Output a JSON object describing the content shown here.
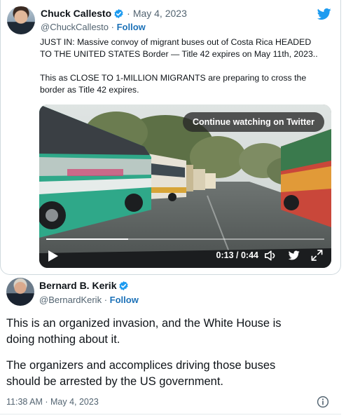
{
  "quoted_tweet": {
    "author_name": "Chuck Callesto",
    "date_sep": "·",
    "date": "May 4, 2023",
    "handle": "@ChuckCallesto",
    "handle_sep": "·",
    "follow_label": "Follow",
    "paragraphs": [
      "JUST IN: Massive convoy of migrant buses out of Costa Rica HEADED\nTO THE UNITED STATES Border — Title 42 expires on May 11th, 2023..",
      "This as CLOSE TO 1-MILLION MIGRANTS are preparing to cross the\nborder as Title 42 expires."
    ]
  },
  "video": {
    "continue_label": "Continue watching on Twitter",
    "time": "0:13 / 0:44",
    "progress": 0.295
  },
  "tweet": {
    "author_name": "Bernard B. Kerik",
    "handle": "@BernardKerik",
    "handle_sep": "·",
    "follow_label": "Follow",
    "paragraphs": [
      "This is an organized invasion, and the White House is\ndoing nothing about it.",
      "The organizers and accomplices driving those buses\nshould be arrested by the US government."
    ],
    "timestamp": "11:38 AM · May 4, 2023"
  },
  "colors": {
    "twitter_blue": "#1d9bf0",
    "link_blue": "#1d72b8",
    "secondary_text": "#536471"
  },
  "icons": {
    "twitter": "twitter-bird-icon",
    "verified": "verified-badge-icon",
    "play": "play-icon",
    "volume": "volume-icon",
    "expand": "expand-icon",
    "info": "info-icon"
  }
}
